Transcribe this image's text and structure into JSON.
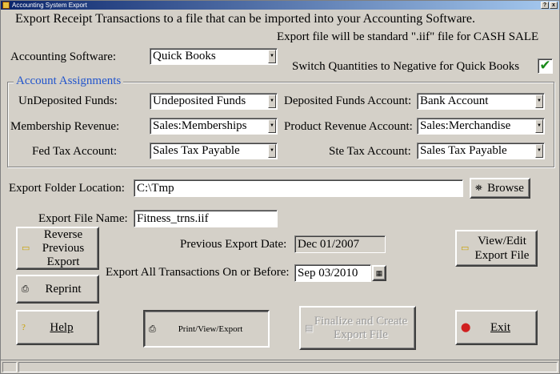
{
  "window": {
    "title": "Accounting System Export",
    "help_btn": "?",
    "close_btn": "x"
  },
  "intro": "Export Receipt Transactions to a file that can be imported into your Accounting Software.",
  "note": "Export file will be standard \".iif\" file for CASH SALE",
  "software": {
    "label": "Accounting Software:",
    "value": "Quick Books"
  },
  "switch_qty": {
    "label": "Switch Quantities to Negative for Quick Books",
    "checked": true,
    "mark": "✔"
  },
  "accounts": {
    "title": "Account Assignments",
    "undeposited": {
      "label": "UnDeposited Funds:",
      "value": "Undeposited Funds"
    },
    "deposited": {
      "label": "Deposited Funds Account:",
      "value": "Bank Account"
    },
    "membership": {
      "label": "Membership Revenue:",
      "value": "Sales:Memberships"
    },
    "product": {
      "label": "Product Revenue Account:",
      "value": "Sales:Merchandise"
    },
    "fed_tax": {
      "label": "Fed Tax Account:",
      "value": "Sales Tax Payable"
    },
    "ste_tax": {
      "label": "Ste Tax Account:",
      "value": "Sales Tax Payable"
    }
  },
  "folder": {
    "label": "Export Folder Location:",
    "value": "C:\\Tmp",
    "browse": "Browse"
  },
  "file_name": {
    "label": "Export File Name:",
    "value": "Fitness_trns.iif"
  },
  "prev_date": {
    "label": "Previous Export Date:",
    "value": "Dec 01/2007"
  },
  "on_before": {
    "label": "Export All Transactions On or Before:",
    "value": "Sep 03/2010"
  },
  "buttons": {
    "reverse_line1": "Reverse",
    "reverse_line2": "Previous",
    "reverse_line3": "Export",
    "view_edit_line1": "View/Edit",
    "view_edit_line2": "Export File",
    "reprint": "Reprint",
    "help": "Help",
    "print_view_export": "Print/View/Export",
    "finalize_line1": "Finalize and Create",
    "finalize_line2": "Export File",
    "exit": "Exit"
  },
  "colors": {
    "group_title": "#2255cc",
    "check": "#1a8a1a",
    "titlebar": "#0a246a"
  }
}
